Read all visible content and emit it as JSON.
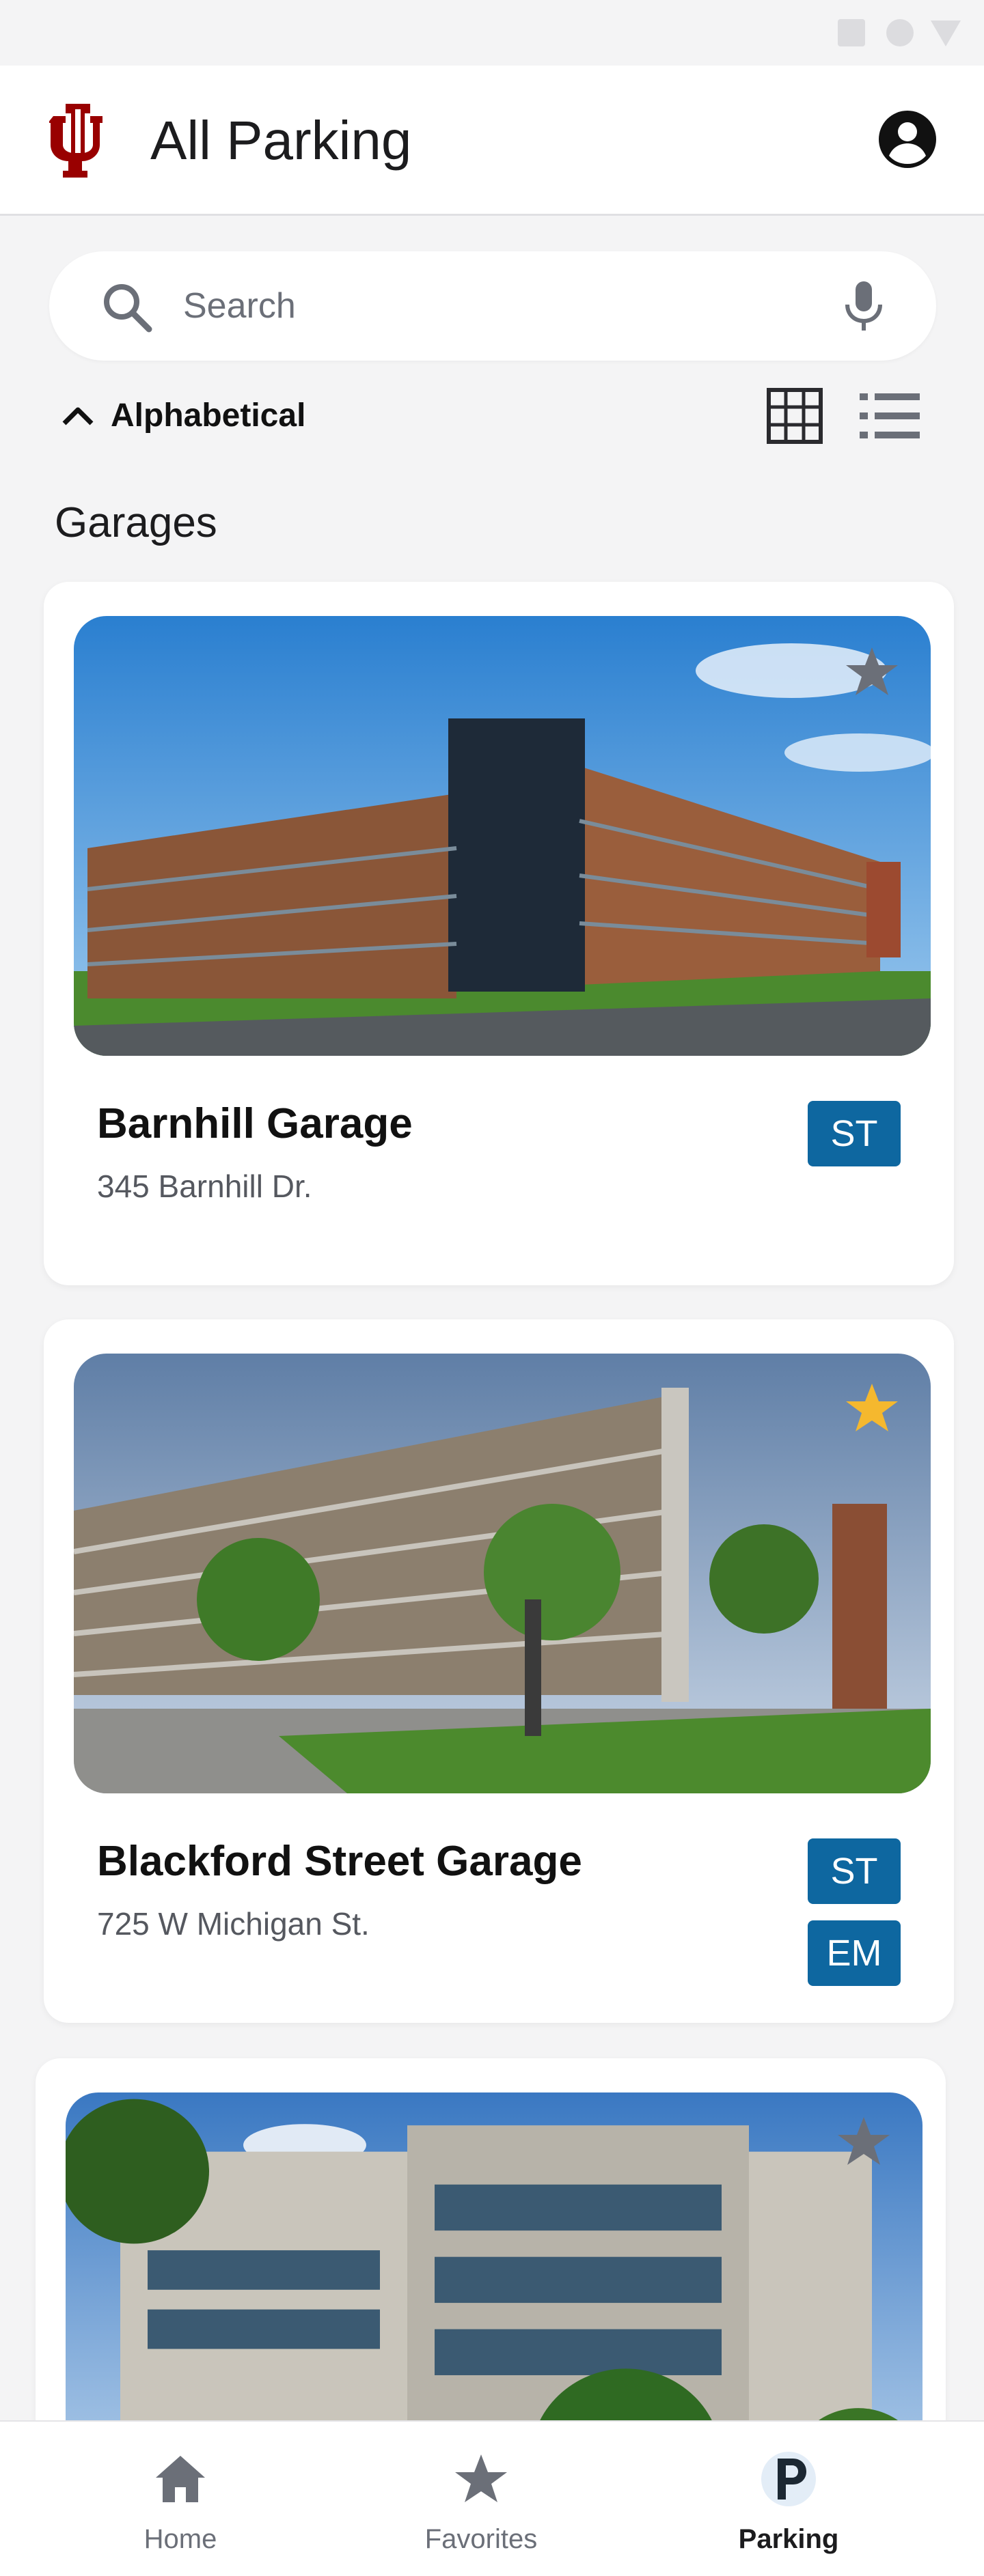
{
  "header": {
    "title": "All Parking",
    "brand_color": "#990000"
  },
  "search": {
    "placeholder": "Search",
    "value": ""
  },
  "sort": {
    "label": "Alphabetical",
    "direction": "ascending"
  },
  "view_options": [
    "grid-view",
    "list-view"
  ],
  "section": {
    "title": "Garages"
  },
  "garages": [
    {
      "name": "Barnhill Garage",
      "address": "345 Barnhill Dr.",
      "badges": [
        "ST"
      ],
      "favorite": false
    },
    {
      "name": "Blackford Street Garage",
      "address": "725 W Michigan St.",
      "badges": [
        "ST",
        "EM"
      ],
      "favorite": true
    },
    {
      "name": "",
      "address": "",
      "badges": [],
      "favorite": false
    }
  ],
  "colors": {
    "badge": "#0e67a0",
    "favorite_on": "#f5b82e",
    "favorite_off": "#6b6f78"
  },
  "nav": {
    "items": [
      {
        "label": "Home",
        "icon": "home-icon",
        "active": false
      },
      {
        "label": "Favorites",
        "icon": "star-icon",
        "active": false
      },
      {
        "label": "Parking",
        "icon": "parking-icon",
        "active": true
      }
    ]
  }
}
